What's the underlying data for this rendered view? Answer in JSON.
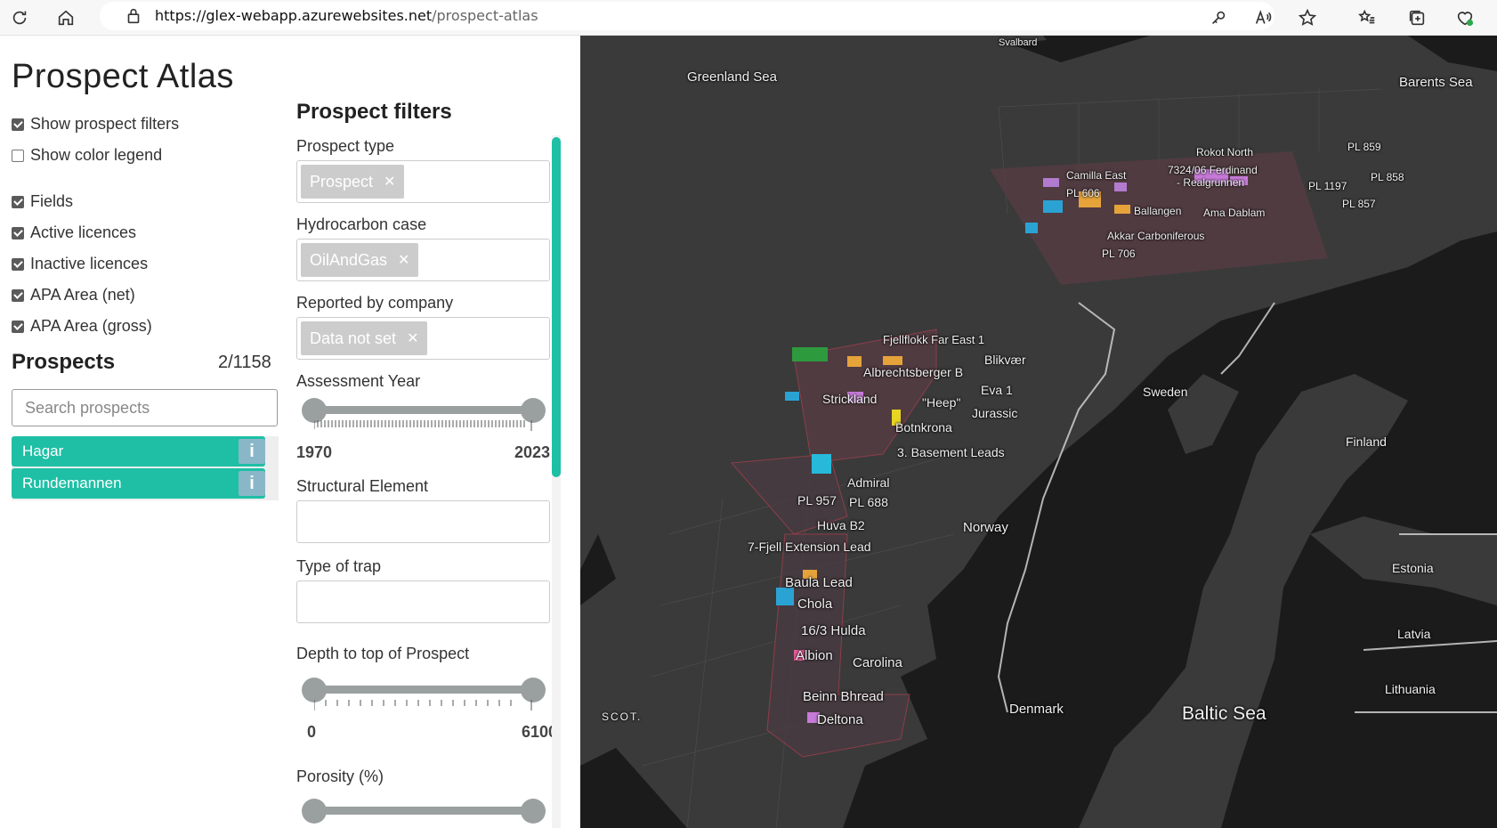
{
  "browser": {
    "url_host": "https://glex-webapp.azurewebsites.net",
    "url_path": "/prospect-atlas"
  },
  "app": {
    "title": "Prospect Atlas",
    "toggles": [
      {
        "label": "Show prospect filters",
        "checked": true
      },
      {
        "label": "Show color legend",
        "checked": false
      }
    ],
    "layers": [
      {
        "label": "Fields",
        "checked": true
      },
      {
        "label": "Active licences",
        "checked": true
      },
      {
        "label": "Inactive licences",
        "checked": true
      },
      {
        "label": "APA Area (net)",
        "checked": true
      },
      {
        "label": "APA Area (gross)",
        "checked": true
      }
    ],
    "prospects_heading": "Prospects",
    "prospects_count": "2/1158",
    "search_placeholder": "Search prospects",
    "prospect_list": [
      {
        "name": "Hagar",
        "info": "i"
      },
      {
        "name": "Rundemannen",
        "info": "i"
      }
    ]
  },
  "filters": {
    "heading": "Prospect filters",
    "prospect_type": {
      "label": "Prospect type",
      "chip": "Prospect"
    },
    "hydrocarbon_case": {
      "label": "Hydrocarbon case",
      "chip": "OilAndGas"
    },
    "reported_by": {
      "label": "Reported by company",
      "chip": "Data not set"
    },
    "assessment_year": {
      "label": "Assessment Year",
      "min": "1970",
      "max": "2023"
    },
    "structural_element": {
      "label": "Structural Element",
      "value": ""
    },
    "type_of_trap": {
      "label": "Type of trap",
      "value": ""
    },
    "depth": {
      "label": "Depth to top of Prospect",
      "min": "0",
      "max": "6100"
    },
    "porosity": {
      "label": "Porosity (%)"
    },
    "chip_remove_glyph": "✕"
  },
  "map": {
    "sea_labels": [
      "Greenland Sea",
      "Barents Sea",
      "Baltic Sea"
    ],
    "country_labels": [
      "Svalbard",
      "Sweden",
      "Finland",
      "Norway",
      "Estonia",
      "Latvia",
      "Lithuania",
      "Denmark",
      "SCOT."
    ],
    "prospect_labels": [
      "Rokot North",
      "PL 859",
      "Camilla East",
      "7324/06 Ferdinand",
      "- Realgrunnen",
      "PL 858",
      "PL 606",
      "PL 1197",
      "Ballangen",
      "Ama Dablam",
      "PL 857",
      "Akkar Carboniferous",
      "PL 706",
      "Fjellflokk Far East 1",
      "Blikvær",
      "Albrechtsberger B",
      "Eva 1",
      "Strickland",
      "\"Heep\"",
      "Jurassic",
      "Botnkrona",
      "3. Basement Leads",
      "Admiral",
      "PL 957",
      "PL 688",
      "Huva B2",
      "7-Fjell Extension Lead",
      "Baula Lead",
      "Chola",
      "16/3 Hulda",
      "Albion",
      "Carolina",
      "Beinn Bhread",
      "Deltona"
    ],
    "colors": {
      "sea": "#3a3a3a",
      "land": "#1b1b1b",
      "accent": "#1ebfa5"
    }
  }
}
